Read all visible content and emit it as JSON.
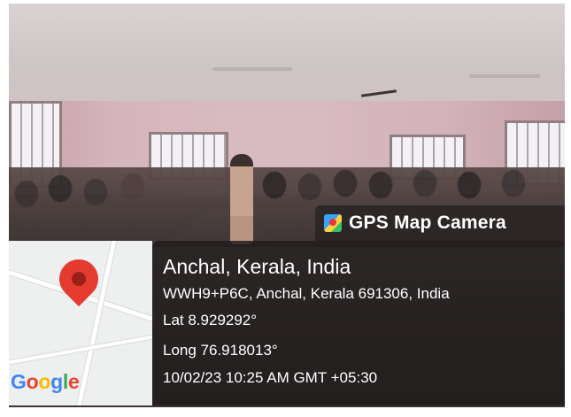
{
  "overlay": {
    "app_name": "GPS Map Camera",
    "place": "Anchal, Kerala, India",
    "address": "WWH9+P6C, Anchal, Kerala 691306, India",
    "lat": "Lat 8.929292°",
    "long": "Long 76.918013°",
    "datetime": "10/02/23 10:25 AM GMT +05:30"
  },
  "map": {
    "logo_text": "Google",
    "pin_icon": "map-pin-icon"
  },
  "colors": {
    "pin": "#e53a2f",
    "panel": "#201b1b"
  }
}
